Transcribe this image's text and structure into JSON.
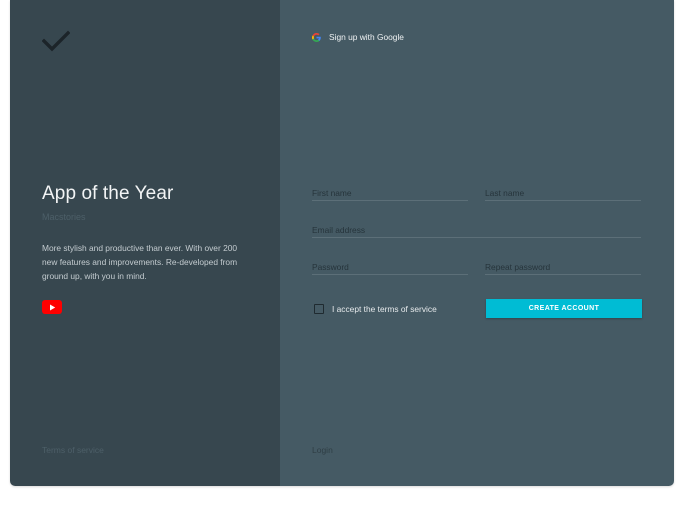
{
  "left_panel": {
    "logo_icon": "checkmark-icon",
    "title": "App of the Year",
    "subtitle": "Macstories",
    "description": "More stylish and productive than ever. With over 200 new features and improvements. Re-developed from ground up, with you in mind.",
    "video_icon": "youtube-icon",
    "terms_link": "Terms of service"
  },
  "right_panel": {
    "google_icon": "google-icon",
    "google_label": "Sign up with Google",
    "form": {
      "first_name": {
        "placeholder": "First name",
        "value": ""
      },
      "last_name": {
        "placeholder": "Last name",
        "value": ""
      },
      "email": {
        "placeholder": "Email address",
        "value": ""
      },
      "password": {
        "placeholder": "Password",
        "value": ""
      },
      "repeat_password": {
        "placeholder": "Repeat password",
        "value": ""
      },
      "accept_label": "I accept the terms of service",
      "accept_checked": false,
      "submit_label": "CREATE ACCOUNT"
    },
    "login_link": "Login"
  },
  "colors": {
    "left_bg": "#37474f",
    "right_bg": "#455a64",
    "accent": "#00bcd4",
    "youtube_red": "#ff0000"
  }
}
